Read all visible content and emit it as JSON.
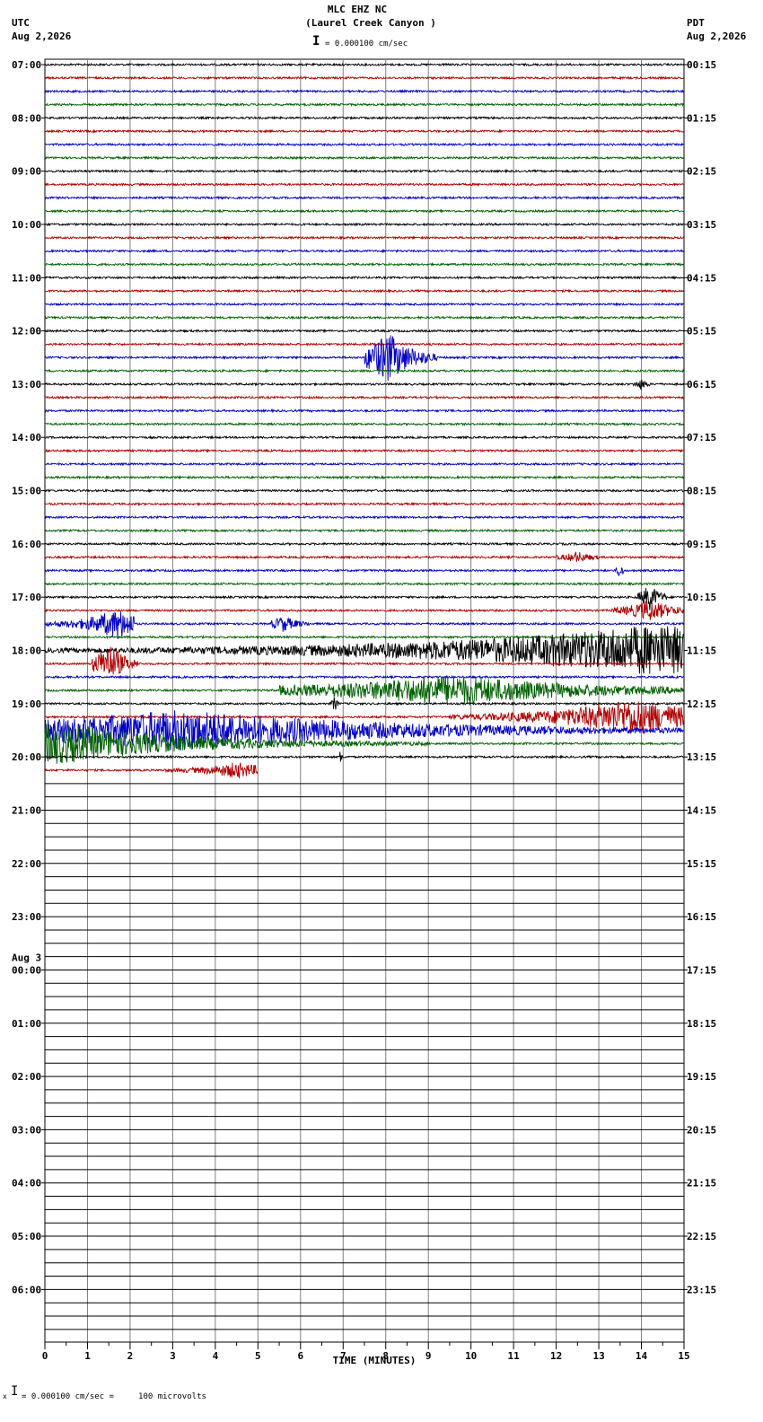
{
  "header": {
    "station": "MLC EHZ NC",
    "location": "(Laurel Creek Canyon )",
    "scale": "= 0.000100 cm/sec",
    "left_tz": "UTC",
    "left_date": "Aug 2,2026",
    "right_tz": "PDT",
    "right_date": "Aug 2,2026"
  },
  "footer": {
    "scale_note": "= 0.000100 cm/sec =     100 microvolts"
  },
  "chart_data": {
    "type": "line",
    "xlabel": "TIME (MINUTES)",
    "xlim": [
      0,
      15
    ],
    "x_ticks": [
      "0",
      "1",
      "2",
      "3",
      "4",
      "5",
      "6",
      "7",
      "8",
      "9",
      "10",
      "11",
      "12",
      "13",
      "14",
      "15"
    ],
    "utc_hour_labels": [
      "07:00",
      "08:00",
      "09:00",
      "10:00",
      "11:00",
      "12:00",
      "13:00",
      "14:00",
      "15:00",
      "16:00",
      "17:00",
      "18:00",
      "19:00",
      "20:00",
      "21:00",
      "22:00",
      "23:00",
      "Aug 3",
      "00:00",
      "01:00",
      "02:00",
      "03:00",
      "04:00",
      "05:00",
      "06:00"
    ],
    "pdt_hour_labels": [
      "00:15",
      "01:15",
      "02:15",
      "03:15",
      "04:15",
      "05:15",
      "06:15",
      "07:15",
      "08:15",
      "09:15",
      "10:15",
      "11:15",
      "12:15",
      "13:15",
      "14:15",
      "15:15",
      "16:15",
      "17:15",
      "18:15",
      "19:15",
      "20:15",
      "21:15",
      "22:15",
      "23:15"
    ],
    "trace_colors": [
      "#000000",
      "#b00000",
      "#0000c0",
      "#006000"
    ],
    "total_rows": 96,
    "recorded_rows": 50,
    "partial_last_row_minutes": 5,
    "events": [
      {
        "row": 22,
        "start": 7.5,
        "end": 9.2,
        "peak": 8.05,
        "amp": 1.0,
        "color_index": 2
      },
      {
        "row": 24,
        "start": 13.8,
        "end": 14.2,
        "peak": 14.0,
        "amp": 0.2,
        "color_index": 0
      },
      {
        "row": 37,
        "start": 12.0,
        "end": 13.0,
        "peak": 12.5,
        "amp": 0.2,
        "color_index": 1
      },
      {
        "row": 38,
        "start": 13.4,
        "end": 13.6,
        "peak": 13.5,
        "amp": 0.35,
        "color_index": 2
      },
      {
        "row": 40,
        "start": 13.9,
        "end": 14.6,
        "peak": 14.2,
        "amp": 0.5,
        "color_index": 0
      },
      {
        "row": 41,
        "start": 13.3,
        "end": 15.0,
        "peak": 14.2,
        "amp": 0.4,
        "color_index": 1
      },
      {
        "row": 42,
        "start": 0.0,
        "end": 2.1,
        "peak": 1.7,
        "amp": 0.6,
        "color_index": 2
      },
      {
        "row": 42,
        "start": 5.3,
        "end": 6.2,
        "peak": 5.6,
        "amp": 0.3,
        "color_index": 2
      },
      {
        "row": 44,
        "start": 0.0,
        "end": 15.0,
        "peak": 14.3,
        "amp": 1.0,
        "color_index": 0
      },
      {
        "row": 45,
        "start": 1.1,
        "end": 2.2,
        "peak": 1.5,
        "amp": 0.8,
        "color_index": 1
      },
      {
        "row": 47,
        "start": 5.5,
        "end": 15.0,
        "peak": 9.5,
        "amp": 0.6,
        "color_index": 3
      },
      {
        "row": 48,
        "start": 6.7,
        "end": 6.9,
        "peak": 6.8,
        "amp": 0.3,
        "color_index": 0
      },
      {
        "row": 49,
        "start": 9.5,
        "end": 15.0,
        "peak": 13.8,
        "amp": 0.7,
        "color_index": 1
      },
      {
        "row": 50,
        "start": 0.0,
        "end": 15.0,
        "peak": 3.2,
        "amp": 0.8,
        "color_index": 2
      },
      {
        "row": 51,
        "start": 0.0,
        "end": 9.0,
        "peak": 0.2,
        "amp": 0.8,
        "color_index": 3
      },
      {
        "row": 52,
        "start": 6.9,
        "end": 7.0,
        "peak": 6.95,
        "amp": 0.3,
        "color_index": 0
      },
      {
        "row": 53,
        "start": 2.8,
        "end": 5.0,
        "peak": 4.5,
        "amp": 0.3,
        "color_index": 1
      }
    ]
  }
}
